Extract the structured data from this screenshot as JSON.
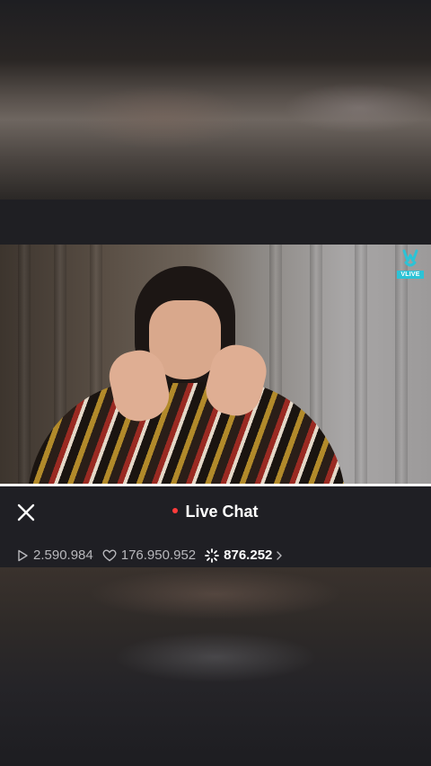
{
  "overlay": {
    "title": "Live Chat",
    "live_indicator_color": "#ff3b3b"
  },
  "stats": {
    "plays": "2.590.984",
    "hearts": "176.950.952",
    "comments": "876.252"
  },
  "video": {
    "watermark": "VLIVE",
    "watermark_color": "#2cc3d6"
  },
  "icons": {
    "close": "close-icon",
    "play": "play-icon",
    "heart": "heart-icon",
    "chat": "chat-burst-icon",
    "chevron": "chevron-right-icon"
  }
}
